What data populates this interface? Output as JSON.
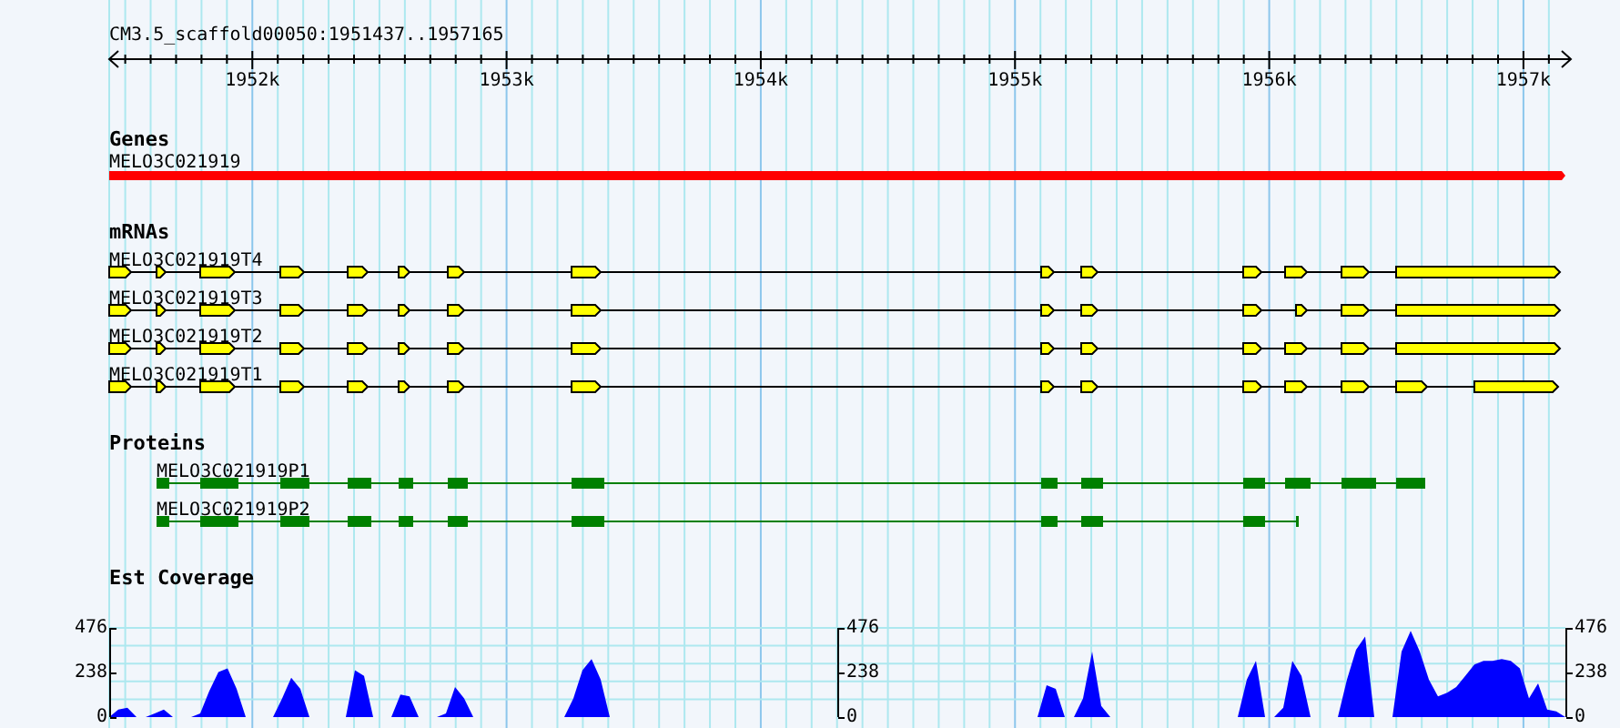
{
  "ruler": {
    "title": "CM3.5_scaffold00050:1951437..1957165",
    "ticks": [
      {
        "label": "1952k"
      },
      {
        "label": "1953k"
      },
      {
        "label": "1954k"
      },
      {
        "label": "1955k"
      },
      {
        "label": "1956k"
      },
      {
        "label": "1957k"
      }
    ]
  },
  "genes": {
    "title": "Genes",
    "items": [
      {
        "name": "MELO3C021919"
      }
    ]
  },
  "mrnas": {
    "title": "mRNAs",
    "items": [
      {
        "name": "MELO3C021919T4"
      },
      {
        "name": "MELO3C021919T3"
      },
      {
        "name": "MELO3C021919T2"
      },
      {
        "name": "MELO3C021919T1"
      }
    ]
  },
  "proteins": {
    "title": "Proteins",
    "items": [
      {
        "name": "MELO3C021919P1"
      },
      {
        "name": "MELO3C021919P2"
      }
    ]
  },
  "coverage": {
    "scales": [
      {
        "tick_labels": [
          "476",
          "238",
          "0"
        ]
      },
      {
        "tick_labels": [
          "476",
          "238",
          "0"
        ]
      },
      {
        "tick_labels": [
          "476",
          "238",
          "0"
        ]
      }
    ],
    "chart_data": {
      "type": "area",
      "title": "Est Coverage",
      "categories": [
        null,
        null,
        null,
        null,
        null,
        null,
        null,
        null,
        null,
        null,
        null,
        null,
        null,
        null,
        null,
        null,
        null,
        null,
        null,
        null,
        null,
        null,
        null,
        null,
        null,
        null,
        null,
        null,
        null,
        null,
        null,
        null,
        null,
        null,
        null,
        null,
        null,
        null,
        null,
        null,
        null,
        null,
        null,
        null,
        null,
        null,
        null,
        null,
        null,
        null,
        null,
        null,
        null,
        null,
        null,
        null,
        null,
        null,
        null,
        null,
        null,
        null,
        null,
        null,
        null,
        null,
        null,
        null,
        null,
        null,
        null,
        null,
        null,
        null,
        null,
        null,
        null,
        null,
        null,
        null,
        null,
        null,
        null,
        null,
        null,
        null,
        null,
        null,
        null,
        null,
        null,
        null,
        null,
        null,
        null,
        null,
        null,
        null,
        null,
        null,
        null,
        null,
        null,
        null,
        null,
        null,
        null,
        null,
        null,
        null,
        null,
        null,
        null,
        null,
        null,
        null,
        null,
        null,
        null,
        null,
        null,
        null,
        null,
        null,
        null,
        null,
        null,
        null,
        null,
        null,
        null,
        null,
        null,
        null,
        null,
        null,
        null,
        null,
        null,
        null,
        null,
        null,
        null,
        null,
        null,
        null,
        null,
        null,
        null,
        null,
        null,
        null,
        null,
        null,
        null,
        null,
        null,
        null,
        null,
        null,
        null
      ],
      "series": [
        {
          "color": "#0000ff",
          "values": [
            0,
            40,
            50,
            0,
            0,
            20,
            40,
            0,
            0,
            0,
            20,
            140,
            240,
            260,
            150,
            0,
            0,
            0,
            0,
            100,
            210,
            150,
            0,
            0,
            0,
            0,
            0,
            250,
            220,
            0,
            0,
            0,
            120,
            110,
            0,
            0,
            0,
            20,
            160,
            100,
            0,
            0,
            0,
            0,
            0,
            0,
            0,
            0,
            0,
            0,
            0,
            100,
            250,
            310,
            200,
            0,
            0,
            0,
            0,
            0,
            0,
            0,
            0,
            0,
            0,
            0,
            0,
            0,
            0,
            0,
            0,
            0,
            0,
            0,
            0,
            0,
            0,
            0,
            0,
            0,
            0,
            0,
            0,
            0,
            0,
            0,
            0,
            0,
            0,
            0,
            0,
            0,
            0,
            0,
            0,
            0,
            0,
            0,
            0,
            0,
            0,
            0,
            0,
            170,
            150,
            0,
            0,
            100,
            350,
            60,
            0,
            0,
            0,
            0,
            0,
            0,
            0,
            0,
            0,
            0,
            0,
            0,
            0,
            0,
            0,
            200,
            300,
            0,
            0,
            50,
            300,
            220,
            0,
            0,
            0,
            0,
            200,
            360,
            430,
            0,
            0,
            0,
            350,
            460,
            350,
            200,
            110,
            130,
            160,
            220,
            280,
            300,
            300,
            310,
            300,
            260,
            100,
            180,
            40,
            30,
            0
          ]
        }
      ],
      "ylim": [
        0,
        476
      ],
      "yticks": [
        0,
        238,
        476
      ]
    }
  }
}
